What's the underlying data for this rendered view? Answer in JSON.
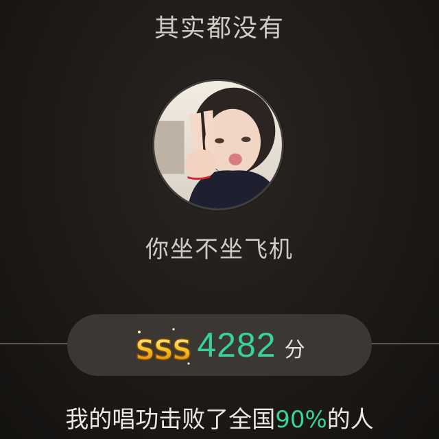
{
  "song": {
    "title": "其实都没有"
  },
  "user": {
    "name": "你坐不坐飞机"
  },
  "score": {
    "grade": "SSS",
    "value": "4282",
    "unit": "分"
  },
  "summary": {
    "prefix": "我的唱功击败了全国",
    "percent": "90%",
    "suffix": "的人"
  },
  "colors": {
    "accent_green": "#37d39a",
    "pill_bg": "#3b3834",
    "grade_gold": "#f3b21c"
  }
}
